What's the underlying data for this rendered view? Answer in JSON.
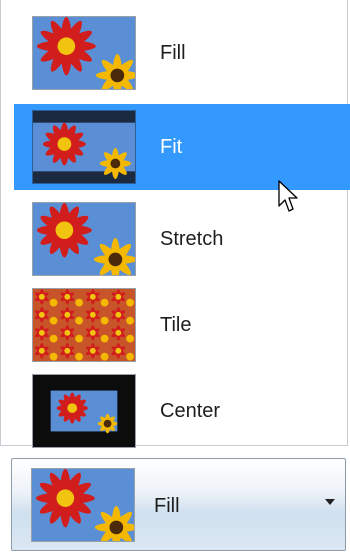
{
  "dropdown": {
    "options": [
      {
        "label": "Fill",
        "icon": "fill-thumbnail-icon"
      },
      {
        "label": "Fit",
        "icon": "fit-thumbnail-icon",
        "selected": true
      },
      {
        "label": "Stretch",
        "icon": "stretch-thumbnail-icon"
      },
      {
        "label": "Tile",
        "icon": "tile-thumbnail-icon"
      },
      {
        "label": "Center",
        "icon": "center-thumbnail-icon"
      }
    ],
    "selection_color": "#3399ff"
  },
  "combo": {
    "value": "Fill",
    "icon": "fill-thumbnail-icon",
    "arrow_icon": "chevron-down-icon"
  }
}
